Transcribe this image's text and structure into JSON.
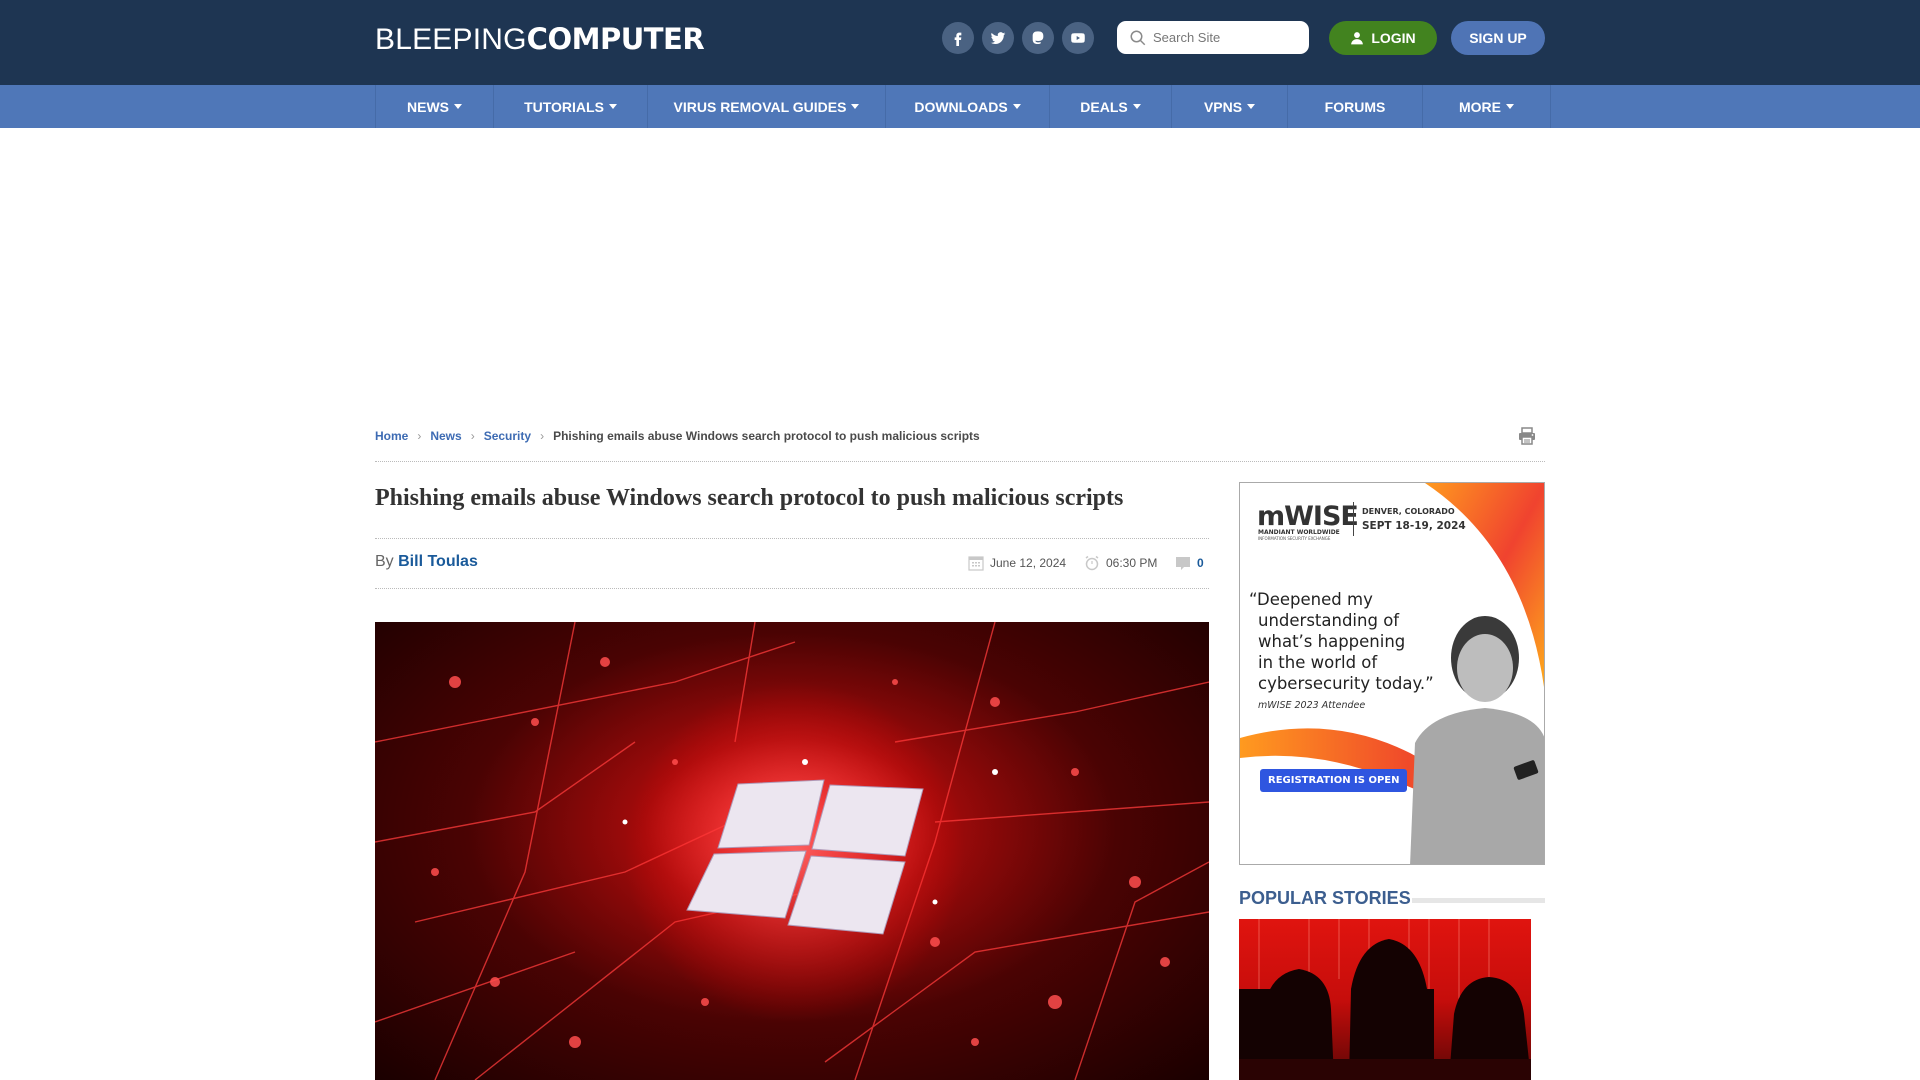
{
  "header": {
    "logo_thin": "BLEEPING",
    "logo_bold": "COMPUTER",
    "social": [
      {
        "name": "facebook-icon"
      },
      {
        "name": "twitter-icon"
      },
      {
        "name": "mastodon-icon"
      },
      {
        "name": "youtube-icon"
      }
    ],
    "search_placeholder": "Search Site",
    "login_label": "LOGIN",
    "signup_label": "SIGN UP"
  },
  "nav": {
    "items": [
      {
        "label": "NEWS",
        "dropdown": true
      },
      {
        "label": "TUTORIALS",
        "dropdown": true
      },
      {
        "label": "VIRUS REMOVAL GUIDES",
        "dropdown": true
      },
      {
        "label": "DOWNLOADS",
        "dropdown": true
      },
      {
        "label": "DEALS",
        "dropdown": true
      },
      {
        "label": "VPNS",
        "dropdown": true
      },
      {
        "label": "FORUMS",
        "dropdown": false
      },
      {
        "label": "MORE",
        "dropdown": true
      }
    ]
  },
  "breadcrumb": {
    "items": [
      "Home",
      "News",
      "Security"
    ],
    "current": "Phishing emails abuse Windows search protocol to push malicious scripts"
  },
  "article": {
    "title": "Phishing emails abuse Windows search protocol to push malicious scripts",
    "by_label": "By",
    "author": "Bill Toulas",
    "date": "June 12, 2024",
    "time": "06:30 PM",
    "comments": "0"
  },
  "ad": {
    "brand": "mWISE",
    "brand_sub1": "MANDIANT WORLDWIDE",
    "brand_sub2": "INFORMATION SECURITY EXCHANGE",
    "location": "DENVER, COLORADO",
    "dates": "SEPT 18-19, 2024",
    "quote": "“Deepened my understanding of what’s happening in the world of cybersecurity today.”",
    "quote_lines": [
      "“Deepened my",
      "understanding of",
      "what’s happening",
      "in the world of",
      "cybersecurity today.”"
    ],
    "attribution": "mWISE 2023 Attendee",
    "cta": "REGISTRATION IS OPEN"
  },
  "sidebar": {
    "popular_title": "POPULAR STORIES"
  },
  "colors": {
    "topbar": "#1e3552",
    "nav": "#4f77b8",
    "login": "#42831f",
    "signup": "#4f74b5",
    "link": "#3d6bb3",
    "author": "#1a5a9a",
    "popular_title": "#3c5e8f",
    "ad_cta": "#2f56e0"
  }
}
